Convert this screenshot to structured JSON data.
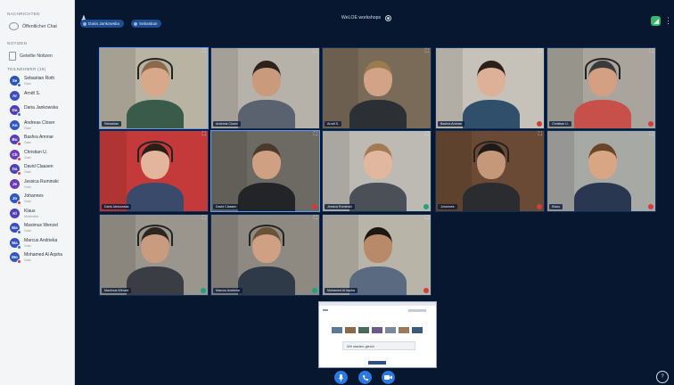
{
  "sidebar": {
    "messages_heading": "NACHRICHTEN",
    "public_chat_label": "Öffentlicher Chat",
    "notes_heading": "NOTIZEN",
    "shared_notes_label": "Geteilte Notizen",
    "participants_heading": "TEILNEHMER (15)",
    "participants": [
      {
        "initials": "Se",
        "name": "Sebastian Roth",
        "role": "Gast",
        "color": "#2a55b3",
        "status": "mic"
      },
      {
        "initials": "Ar",
        "name": "Arndt S.",
        "role": "",
        "color": "#3a4fc0",
        "status": "none"
      },
      {
        "initials": "Da",
        "name": "Daria Jankowska",
        "role": "",
        "color": "#4f3fb8",
        "status": "mic"
      },
      {
        "initials": "An",
        "name": "Andreas Closer",
        "role": "Gast",
        "color": "#3157c2",
        "status": "none"
      },
      {
        "initials": "Bu",
        "name": "Bashra Ammar",
        "role": "Gast",
        "color": "#5440b9",
        "status": "muted"
      },
      {
        "initials": "Ch",
        "name": "Christian U.",
        "role": "Gast",
        "color": "#6a3db7",
        "status": "muted"
      },
      {
        "initials": "Da",
        "name": "David Claasen",
        "role": "Gast",
        "color": "#4f3fb8",
        "status": "muted"
      },
      {
        "initials": "Je",
        "name": "Jessica Ruminski",
        "role": "Gast",
        "color": "#6a3db7",
        "status": "none"
      },
      {
        "initials": "Jo",
        "name": "Johannes",
        "role": "Gast",
        "color": "#3157c2",
        "status": "muted"
      },
      {
        "initials": "Kl",
        "name": "Klaus",
        "role": "Moderator",
        "color": "#4f3fb8",
        "status": "none"
      },
      {
        "initials": "Ma",
        "name": "Maximus Wenzel",
        "role": "Gast",
        "color": "#3a4fc0",
        "status": "mic"
      },
      {
        "initials": "Ma",
        "name": "Marcus Andrieka",
        "role": "Gast",
        "color": "#3a4fc0",
        "status": "mic"
      },
      {
        "initials": "Mo",
        "name": "Mohamed Al Aqsha",
        "role": "Gast",
        "color": "#3157c2",
        "status": "muted"
      }
    ]
  },
  "topbar": {
    "presenters": [
      "Daria Jankowska",
      "Sebastian"
    ],
    "meeting_title": "WeLOE workshops"
  },
  "tiles": [
    {
      "name": "Sebastian",
      "wall": "#b9b3a4",
      "skin": "#d7a98a",
      "hair": "#8a6a4a",
      "shirt": "#3a5a4a",
      "headset": true,
      "status": "none",
      "active": true
    },
    {
      "name": "Andreas Closer",
      "wall": "#b7b2a9",
      "skin": "#c99a7c",
      "hair": "#2d231c",
      "shirt": "#5a6270",
      "headset": false,
      "status": "none",
      "active": false
    },
    {
      "name": "Arndt S.",
      "wall": "#7a6a58",
      "skin": "#d2a386",
      "hair": "#9a7a4f",
      "shirt": "#2c2f33",
      "headset": false,
      "status": "none",
      "active": false
    },
    {
      "name": "Bashra Ammar",
      "wall": "#c7c2b9",
      "skin": "#dcb198",
      "hair": "#2a1f19",
      "shirt": "#2f4f6a",
      "headset": false,
      "status": "muted",
      "active": false
    },
    {
      "name": "Christian U.",
      "wall": "#a9a59c",
      "skin": "#d4a083",
      "hair": "#3a3a3a",
      "shirt": "#c8504a",
      "headset": true,
      "status": "muted",
      "active": false
    },
    {
      "name": "Daria Jankowska",
      "wall": "#c43a3a",
      "skin": "#e2b59c",
      "hair": "#2a1e18",
      "shirt": "#3a4a6a",
      "headset": true,
      "status": "none",
      "active": false
    },
    {
      "name": "David Claasen",
      "wall": "#6c6a63",
      "skin": "#cfa082",
      "hair": "#4a3a2c",
      "shirt": "#222428",
      "headset": false,
      "status": "muted",
      "active": true
    },
    {
      "name": "Jessica Ruminski",
      "wall": "#bdbab3",
      "skin": "#e1b7a0",
      "hair": "#a27a52",
      "shirt": "#4a4f58",
      "headset": false,
      "status": "mic",
      "active": false
    },
    {
      "name": "Johannes",
      "wall": "#6a4a34",
      "skin": "#c6987a",
      "hair": "#1e1a17",
      "shirt": "#2a2c30",
      "headset": true,
      "status": "muted",
      "active": false
    },
    {
      "name": "Klaus",
      "wall": "#a7a9a5",
      "skin": "#d8a585",
      "hair": "#6a4528",
      "shirt": "#2a3750",
      "headset": false,
      "status": "muted",
      "active": false
    },
    {
      "name": "Maximus Wenzel",
      "wall": "#9a968d",
      "skin": "#c99c80",
      "hair": "#2c2620",
      "shirt": "#3a3e44",
      "headset": true,
      "status": "mic",
      "active": false
    },
    {
      "name": "Marcus Andrieka",
      "wall": "#8e8a82",
      "skin": "#cfa084",
      "hair": "#6a5238",
      "shirt": "#2e3a48",
      "headset": true,
      "status": "mic",
      "active": false
    },
    {
      "name": "Mohamed Al Aqsha",
      "wall": "#b8b4a8",
      "skin": "#b88a6a",
      "hair": "#1c1714",
      "shirt": "#5a6a80",
      "headset": false,
      "status": "muted",
      "active": false
    }
  ],
  "screenshare": {
    "slide_title": "Wir starten gleich",
    "thumb_colors": [
      "#5a7a9a",
      "#8a6a4a",
      "#4a6a5a",
      "#6a5a8a",
      "#7a8a9a",
      "#9a7a5a",
      "#3a5a7a"
    ]
  },
  "actions": {
    "mic_icon": "microphone-icon",
    "phone_icon": "phone-icon",
    "camera_icon": "camera-icon",
    "accent": "#2a78e0"
  }
}
